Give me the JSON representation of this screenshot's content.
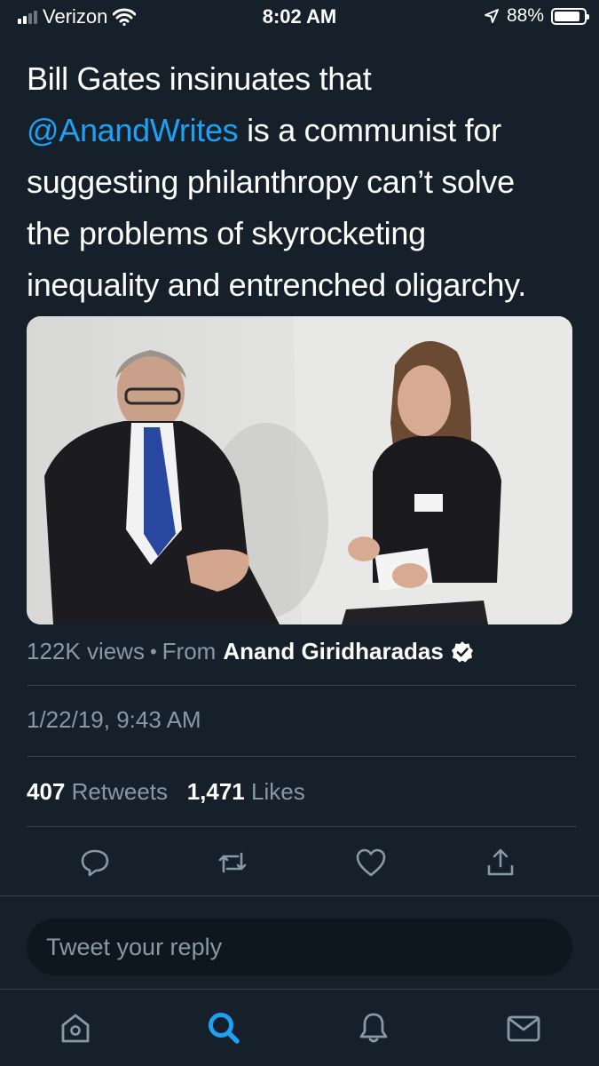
{
  "status_bar": {
    "carrier": "Verizon",
    "time": "8:02 AM",
    "battery": "88%",
    "battery_level": 0.88,
    "signal_bars_filled": 2,
    "signal_bars_total": 4,
    "icons": [
      "wifi-icon",
      "location-arrow-icon",
      "battery-icon"
    ]
  },
  "tweet": {
    "text_lines": [
      "Bill Gates insinuates that",
      "@AnandWrites",
      " is a communist for",
      "suggesting philanthropy can’t solve",
      "the problems of skyrocketing",
      "inequality and entrenched oligarchy."
    ],
    "media": {
      "type": "video",
      "views": "122K views",
      "separator": "•",
      "from_label": "From",
      "author": "Anand Giridharadas",
      "verified_icon": "verified-badge-icon"
    },
    "timestamp": "1/22/19, 9:43 AM",
    "retweets_count": "407",
    "retweets_label": "Retweets",
    "likes_count": "1,471",
    "likes_label": "Likes",
    "actions": [
      "reply-icon",
      "retweet-icon",
      "like-icon",
      "share-icon"
    ]
  },
  "reply": {
    "placeholder": "Tweet your reply"
  },
  "tabbar": {
    "tabs": [
      "home-icon",
      "search-icon",
      "notifications-icon",
      "messages-icon"
    ],
    "active": "search-icon"
  },
  "colors": {
    "background": "#15202b",
    "accent": "#1da1f2",
    "muted": "#8899a6",
    "divider": "#38444d"
  }
}
